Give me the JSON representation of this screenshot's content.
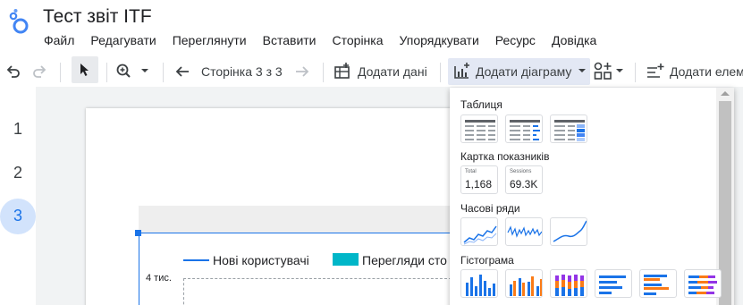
{
  "app": {
    "title": "Тест звіт ITF",
    "menu": [
      "Файл",
      "Редагувати",
      "Переглянути",
      "Вставити",
      "Сторінка",
      "Упорядкувати",
      "Ресурс",
      "Довідка"
    ]
  },
  "toolbar": {
    "page_indicator": "Сторінка 3 з 3",
    "add_data_label": "Додати дані",
    "add_chart_label": "Додати діаграму",
    "add_control_label": "Додати елем"
  },
  "pages": [
    "1",
    "2",
    "3"
  ],
  "active_page": 3,
  "report": {
    "legend": [
      "Нові користувачі",
      "Перегляди сто"
    ],
    "y_tick": "4 тис."
  },
  "dropdown": {
    "sections": {
      "table": "Таблиця",
      "scorecard": "Картка показників",
      "timeseries": "Часові ряди",
      "histogram": "Гістограма"
    },
    "scorecards": [
      {
        "label": "Total",
        "value": "1,168"
      },
      {
        "label": "Sessions",
        "value": "69.3K"
      }
    ]
  },
  "colors": {
    "accent": "#1a73e8",
    "teal": "#00b6c8",
    "orange": "#fa7b17",
    "purple": "#9334e6",
    "active_page_bg": "#d2e3fc"
  }
}
